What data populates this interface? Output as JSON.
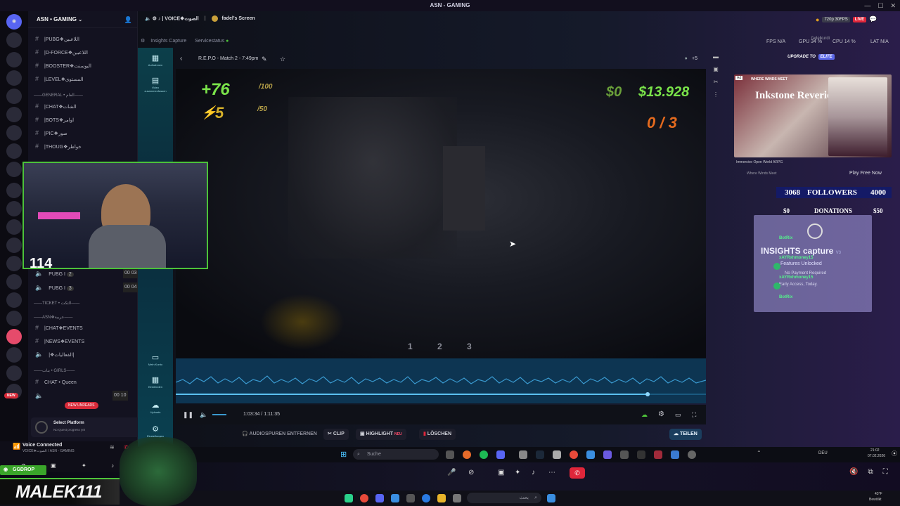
{
  "window": {
    "title": "ASN - GAMING"
  },
  "server": {
    "name": "ASN • GAMING",
    "channels": [
      {
        "label": "|PUBG❖اللاعبين"
      },
      {
        "label": "|D-FORCE❖اللاعبين"
      },
      {
        "label": "|BOOSTER❖البوستت"
      },
      {
        "label": "|LEVEL❖المستوى"
      }
    ],
    "categories": {
      "general": "——GENERAL • العام——",
      "ticket": "——TICKET • التكت——",
      "asn": "——ASN❖عربية——",
      "girls": "——بنات • GIRLS——"
    },
    "general_channels": [
      {
        "label": "|CHAT❖الشات"
      },
      {
        "label": "|BOTS❖اوامر"
      },
      {
        "label": "|PIC❖صور"
      },
      {
        "label": "|THOUG❖خواطر"
      }
    ],
    "voice_channels": [
      {
        "label": "PUBG I",
        "count": "2",
        "nums": "00 03"
      },
      {
        "label": "PUBG I",
        "count": "3",
        "nums": "00 04"
      }
    ],
    "asn_channels": [
      {
        "label": "|CHAT❖EVENTS"
      },
      {
        "label": "|NEWS❖EVENTS"
      },
      {
        "label": "|❖الفعاليات|"
      }
    ],
    "girls_channel": {
      "label": "CHAT • Queen"
    },
    "girls_voice": {
      "nums": "00 10"
    },
    "unreads": "NEW UNREADS",
    "new_badge": "NEW",
    "platform": {
      "title": "Select Platform",
      "subtitle": "No Quest progress yet"
    },
    "voice": {
      "status": "Voice Connected",
      "channel": "VOICE❖الصوت / ASN - GAMING"
    }
  },
  "call_header": {
    "voice": "VOICE❖الصوت",
    "screen": "fadel's Screen"
  },
  "top_right": {
    "quality": "720p 30FPS",
    "live": "LIVE"
  },
  "webcam": {
    "counter": "114"
  },
  "insights": {
    "tabs": [
      "Insights Capture",
      "Servicestatus"
    ],
    "sidebar": [
      "Aufnahmen",
      "Video zusammenfassen",
      "Mein Konto",
      "Einblenden",
      "Uploads",
      "Einstellungen"
    ],
    "title": "R.E.P.O - Match 2 - 7:49pm",
    "plus_count": "+5",
    "time": "1:03:34 / 1:11:35",
    "progress": 0.89,
    "actions": {
      "remove_audio": "AUDIOSPUREN ENTFERNEN",
      "clip": "CLIP",
      "highlight": "HIGHLIGHT",
      "highlight_badge": "NEU",
      "delete": "LÖSCHEN",
      "share": "TEILEN"
    }
  },
  "game": {
    "health": "+76",
    "health_max": "/100",
    "stamina": "5",
    "stamina_max": "/50",
    "money": "$0",
    "goal": "$13.928",
    "extract": "0 / 3",
    "slots": [
      "1",
      "2",
      "3"
    ]
  },
  "perf": {
    "fps": "FPS N/A",
    "gpu": "GPU 34 %",
    "cpu": "CPU 14 %",
    "lat": "LAT N/A",
    "user": "fadelkurdi",
    "upgrade": "UPGRADE TO",
    "elite": "ELITE"
  },
  "ad": {
    "game_line": "WHERE WINDS MEET",
    "title": "Inkstone Reverie",
    "caption": "Immersive Open World ARPG",
    "publisher": "Where Winds Meet",
    "cta": "Play Free Now"
  },
  "stream_goals": {
    "followers_current": "3068",
    "followers_label": "FOLLOWERS",
    "followers_goal": "4000",
    "donations_current": "$0",
    "donations_label": "DONATIONS",
    "donations_goal": "$50"
  },
  "chat": {
    "messages": [
      "BotRix",
      "xAYRxhmoney15",
      "xAYRxhmoney15",
      "BotRix"
    ],
    "watermark": "INSIGHTS capture",
    "wm_version": "V3",
    "wm_line1": "Features Unlocked",
    "wm_line2": "No Payment Required",
    "wm_line3": "Early Access, Today."
  },
  "taskbar": {
    "search": "Suche",
    "lang": "DEU",
    "time": "21:02",
    "date": "07.02.2026",
    "weather": "43°F",
    "weather_desc": "Bewölkt",
    "search2": "بحث"
  },
  "overlay": {
    "ggdrop": "GGDROP",
    "name": "MALEK111"
  },
  "colors": {
    "accent": "#4ec43a",
    "live": "#e0263a",
    "followers_bg": "#141a66",
    "app_side": "#0c3f4a"
  }
}
